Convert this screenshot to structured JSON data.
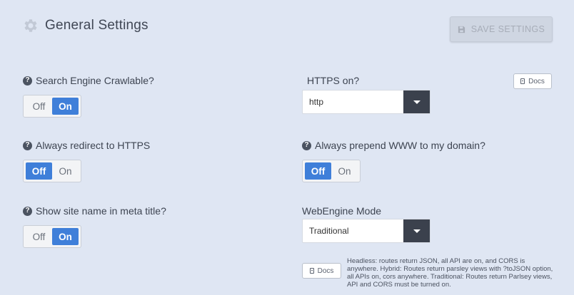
{
  "header": {
    "title": "General Settings",
    "save_label": "SAVE SETTINGS",
    "icon": "gear-icon"
  },
  "settings": {
    "crawlable": {
      "label": "Search Engine Crawlable?",
      "off": "Off",
      "on": "On",
      "selected": "On"
    },
    "redirect_https": {
      "label": "Always redirect to HTTPS",
      "off": "Off",
      "on": "On",
      "selected": "Off"
    },
    "site_name_meta": {
      "label": "Show site name in meta title?",
      "off": "Off",
      "on": "On",
      "selected": "On"
    },
    "https_on": {
      "label": "HTTPS on?",
      "value": "http",
      "docs_label": "Docs"
    },
    "prepend_www": {
      "label": "Always prepend WWW to my domain?",
      "off": "Off",
      "on": "On",
      "selected": "Off"
    },
    "webengine_mode": {
      "label": "WebEngine Mode",
      "value": "Traditional",
      "docs_label": "Docs",
      "help_text": "Headless: routes return JSON, all API are on, and CORS is anywhere. Hybrid: Routes return parsley views with ?toJSON option, all APIs on, cors anywhere. Traditional: Routes return Parlsey views, API and CORS must be turned on."
    }
  },
  "colors": {
    "background": "#dfe6f3",
    "accent": "#3f7fd9",
    "select_caret_bg": "#3b414d",
    "save_button_bg": "#cfd6e2"
  }
}
